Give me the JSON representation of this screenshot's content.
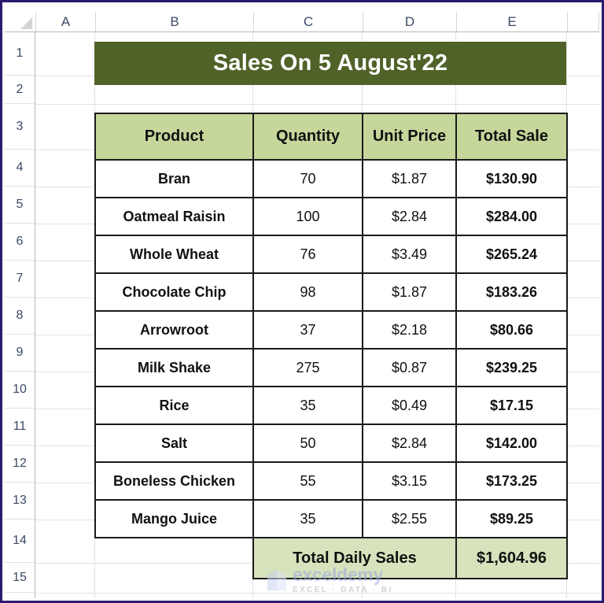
{
  "spreadsheet": {
    "column_headers": [
      "A",
      "B",
      "C",
      "D",
      "E"
    ],
    "row_headers": [
      "1",
      "2",
      "3",
      "4",
      "5",
      "6",
      "7",
      "8",
      "9",
      "10",
      "11",
      "12",
      "13",
      "14",
      "15"
    ],
    "colors": {
      "title_banner_bg": "#4F6228",
      "title_banner_text": "#FFFFFF",
      "table_header_bg": "#C5D79B",
      "total_row_bg": "#D6E3BC",
      "grid_border": "#1A1A1A",
      "window_border": "#2D1A6E"
    }
  },
  "title": {
    "text": "Sales On 5 August'22"
  },
  "table": {
    "headers": [
      "Product",
      "Quantity",
      "Unit Price",
      "Total Sale"
    ],
    "rows": [
      {
        "product": "Bran",
        "quantity": "70",
        "unit_price": "$1.87",
        "total_sale": "$130.90"
      },
      {
        "product": "Oatmeal Raisin",
        "quantity": "100",
        "unit_price": "$2.84",
        "total_sale": "$284.00"
      },
      {
        "product": "Whole Wheat",
        "quantity": "76",
        "unit_price": "$3.49",
        "total_sale": "$265.24"
      },
      {
        "product": "Chocolate Chip",
        "quantity": "98",
        "unit_price": "$1.87",
        "total_sale": "$183.26"
      },
      {
        "product": "Arrowroot",
        "quantity": "37",
        "unit_price": "$2.18",
        "total_sale": "$80.66"
      },
      {
        "product": "Milk Shake",
        "quantity": "275",
        "unit_price": "$0.87",
        "total_sale": "$239.25"
      },
      {
        "product": "Rice",
        "quantity": "35",
        "unit_price": "$0.49",
        "total_sale": "$17.15"
      },
      {
        "product": "Salt",
        "quantity": "50",
        "unit_price": "$2.84",
        "total_sale": "$142.00"
      },
      {
        "product": "Boneless Chicken",
        "quantity": "55",
        "unit_price": "$3.15",
        "total_sale": "$173.25"
      },
      {
        "product": "Mango Juice",
        "quantity": "35",
        "unit_price": "$2.55",
        "total_sale": "$89.25"
      }
    ],
    "total_row": {
      "label": "Total Daily Sales",
      "value": "$1,604.96"
    }
  },
  "watermark": {
    "main": "exceldemy",
    "sub": "EXCEL · DATA · BI"
  }
}
